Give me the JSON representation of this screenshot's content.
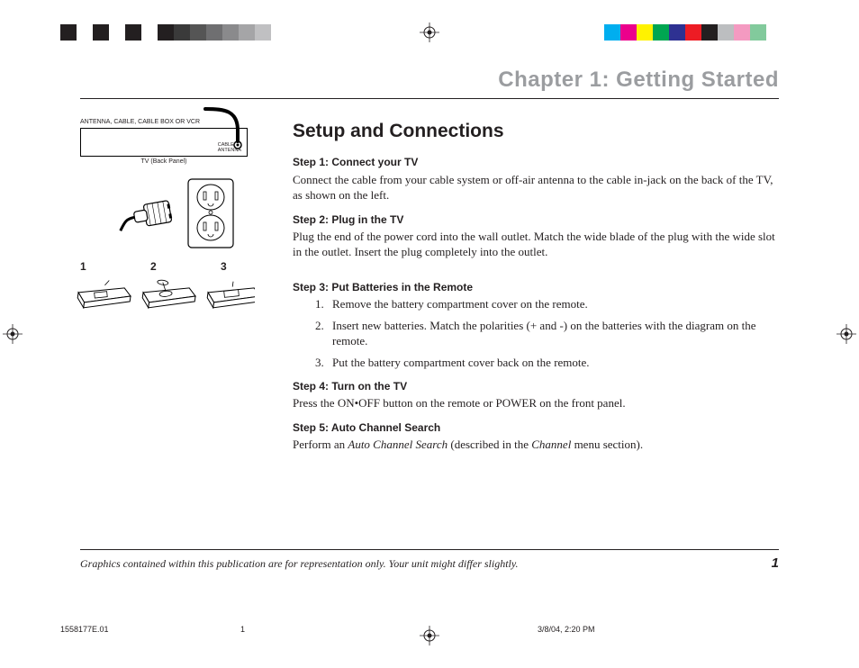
{
  "chapterTitle": "Chapter 1: Getting Started",
  "sectionTitle": "Setup and Connections",
  "illus": {
    "labelTop": "ANTENNA, CABLE, CABLE BOX OR VCR",
    "tvPanelCaption": "TV (Back Panel)",
    "jackLabel1": "CABLE/",
    "jackLabel2": "ANTENNA",
    "remoteNums": {
      "n1": "1",
      "n2": "2",
      "n3": "3"
    }
  },
  "steps": {
    "s1": {
      "hd": "Step 1: Connect your TV",
      "body": "Connect the cable from your cable system or off-air antenna to the cable in-jack on the back of the TV, as shown on the left."
    },
    "s2": {
      "hd": "Step 2: Plug in the TV",
      "body": "Plug the end of the power cord into the wall outlet. Match the wide blade of the plug with the wide slot in the outlet. Insert the plug completely into the outlet."
    },
    "s3": {
      "hd": "Step 3: Put Batteries in the Remote",
      "li1": "Remove the battery compartment cover on the remote.",
      "li2": "Insert new batteries. Match the polarities (+ and -) on the batteries with the diagram on the remote.",
      "li3": "Put the battery compartment cover back on the remote."
    },
    "s4": {
      "hd": "Step 4: Turn on the TV",
      "body": "Press the ON•OFF button on the remote or POWER on the front panel."
    },
    "s5": {
      "hd": "Step 5: Auto Channel Search",
      "body_a": "Perform an ",
      "body_b": "Auto Channel Search",
      "body_c": " (described in the ",
      "body_d": "Channel",
      "body_e": " menu section)."
    }
  },
  "footer": {
    "disclaimer": "Graphics contained within this publication are for representation only. Your unit might differ slightly.",
    "pageNum": "1"
  },
  "slug": {
    "docId": "1558177E.01",
    "pageNum": "1",
    "date": "3/8/04, 2:20 PM"
  },
  "colors": {
    "leftBars": [
      "#231f20",
      "#fff",
      "#231f20",
      "#fff",
      "#231f20",
      "#fff",
      "#231f20",
      "#3a3a3a",
      "#555",
      "#6f6f71",
      "#8a8a8c",
      "#a5a5a7",
      "#c0c0c2"
    ],
    "rightBars": [
      "#00aeef",
      "#ec008c",
      "#fff200",
      "#00a651",
      "#2e3192",
      "#ed1c24",
      "#231f20",
      "#bcbec0",
      "#f49ac1",
      "#82ca9c",
      "#fff",
      "#fff"
    ]
  }
}
